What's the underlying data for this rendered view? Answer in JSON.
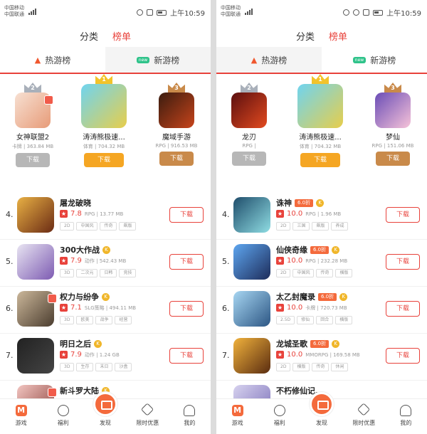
{
  "screens": [
    {
      "status": {
        "carrier1": "中国移动",
        "carrier2": "中国联通",
        "time": "上午10:59"
      },
      "topnav": {
        "tabs": [
          "分类",
          "榜单"
        ]
      },
      "subtabs": {
        "hot": "热游榜",
        "new": "新游榜",
        "new_badge": "new"
      },
      "podium": [
        {
          "rank": "2",
          "name": "女神联盟2",
          "meta": "卡牌 | 363.84 MB",
          "button": "下载"
        },
        {
          "rank": "1",
          "name": "涛涛熊极速...",
          "meta": "体育 | 704.32 MB",
          "button": "下载"
        },
        {
          "rank": "3",
          "name": "魔域手游",
          "meta": "RPG | 916.53 MB",
          "button": "下载"
        }
      ],
      "list": [
        {
          "rank": "4.",
          "name": "屠龙破晓",
          "score": "7.8",
          "meta": "RPG | 13.77 MB",
          "tags": [
            "2D",
            "中国风",
            "传奇",
            "飙版"
          ],
          "button": "下载"
        },
        {
          "rank": "5.",
          "name": "300大作战",
          "score": "7.9",
          "meta": "动作 | 542.43 MB",
          "tags": [
            "3D",
            "二次元",
            "日韩",
            "竞技"
          ],
          "button": "下载"
        },
        {
          "rank": "6.",
          "name": "权力与纷争",
          "score": "7.1",
          "meta": "SLG策略 | 494.11 MB",
          "tags": [
            "3D",
            "欧美",
            "战争",
            "经营"
          ],
          "button": "下载"
        },
        {
          "rank": "7.",
          "name": "明日之后",
          "score": "7.9",
          "meta": "动作 | 1.24 GB",
          "tags": [
            "3D",
            "生存",
            "末日",
            "沙盒"
          ],
          "button": "下载"
        },
        {
          "rank": "",
          "name": "新斗罗大陆"
        }
      ]
    },
    {
      "status": {
        "carrier1": "中国移动",
        "carrier2": "中国联通",
        "time": "上午10:59"
      },
      "topnav": {
        "tabs": [
          "分类",
          "榜单"
        ]
      },
      "subtabs": {
        "hot": "热游榜",
        "new": "新游榜",
        "new_badge": "new"
      },
      "podium": [
        {
          "rank": "2",
          "name": "龙刃",
          "meta": "RPG |",
          "button": "下载"
        },
        {
          "rank": "1",
          "name": "涛涛熊极速...",
          "meta": "体育 | 704.32 MB",
          "button": "下载"
        },
        {
          "rank": "3",
          "name": "梦仙",
          "meta": "RPG | 151.06 MB",
          "button": "下载"
        }
      ],
      "list": [
        {
          "rank": "4.",
          "name": "诛神",
          "discount": "6.0折",
          "score": "10.0",
          "meta": "RPG | 1.96 MB",
          "tags": [
            "2D",
            "三国",
            "飙版",
            "养成"
          ],
          "button": "下载"
        },
        {
          "rank": "5.",
          "name": "仙侠奇缘",
          "discount": "6.0折",
          "score": "10.0",
          "meta": "RPG | 232.28 MB",
          "tags": [
            "2D",
            "中国风",
            "传奇",
            "横版"
          ],
          "button": "下载"
        },
        {
          "rank": "6.",
          "name": "太乙封魔录",
          "discount": "6.0折",
          "score": "10.0",
          "meta": "卡牌 | 720.73 MB",
          "tags": [
            "2.5D",
            "修仙",
            "回合",
            "横版"
          ],
          "button": "下载"
        },
        {
          "rank": "7.",
          "name": "龙城圣歌",
          "discount": "6.0折",
          "score": "10.0",
          "meta": "MMORPG | 169.58 MB",
          "tags": [
            "2D",
            "横版",
            "传奇",
            "休闲"
          ],
          "button": "下载"
        },
        {
          "rank": "",
          "name": "不朽修仙记..."
        }
      ]
    }
  ],
  "bottomnav": [
    "游戏",
    "福利",
    "发现",
    "限时优惠",
    "我的"
  ],
  "colors": {
    "accent": "#e8423b",
    "orange": "#f46a3c",
    "gold": "#f2c32b"
  }
}
